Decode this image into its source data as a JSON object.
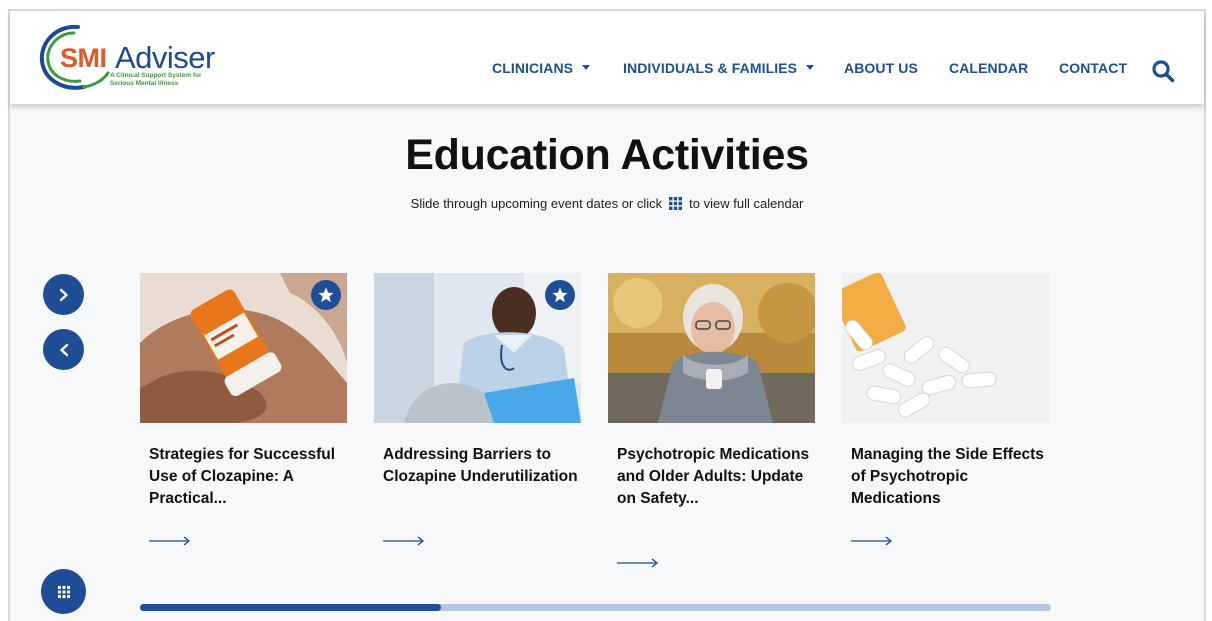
{
  "header": {
    "logo": {
      "smi": "SMI",
      "adviser": "Adviser",
      "tagline": "A Clinical Support System for Serious Mental Illness"
    },
    "nav": [
      {
        "label": "CLINICIANS",
        "dropdown": true
      },
      {
        "label": "INDIVIDUALS & FAMILIES",
        "dropdown": true
      },
      {
        "label": "ABOUT US",
        "dropdown": false
      },
      {
        "label": "CALENDAR",
        "dropdown": false
      },
      {
        "label": "CONTACT",
        "dropdown": false
      }
    ],
    "search_icon": "search-icon"
  },
  "main": {
    "title": "Education Activities",
    "subtitle_before": "Slide through upcoming event dates or click",
    "subtitle_after": "to view full calendar"
  },
  "carousel": {
    "next_icon": "chevron-right-icon",
    "prev_icon": "chevron-left-icon",
    "calendar_icon": "grid-icon",
    "progress": 0.33,
    "cards": [
      {
        "title": "Strategies for Successful Use of Clozapine: A Practical...",
        "starred": true,
        "image": "pill-bottle-in-hand"
      },
      {
        "title": "Addressing Barriers to Clozapine Underutilization",
        "starred": true,
        "image": "doctor-writing"
      },
      {
        "title": "Psychotropic Medications and Older Adults: Update on Safety...",
        "starred": false,
        "image": "older-woman-with-pills"
      },
      {
        "title": "Managing the Side Effects of Psychotropic Medications",
        "starred": false,
        "image": "pills-spilled"
      }
    ]
  },
  "colors": {
    "brand_blue": "#1f4e96",
    "nav_blue": "#1d4f91",
    "logo_orange": "#e1592a",
    "logo_green": "#3c9c3a",
    "track": "#b8c6dd"
  }
}
